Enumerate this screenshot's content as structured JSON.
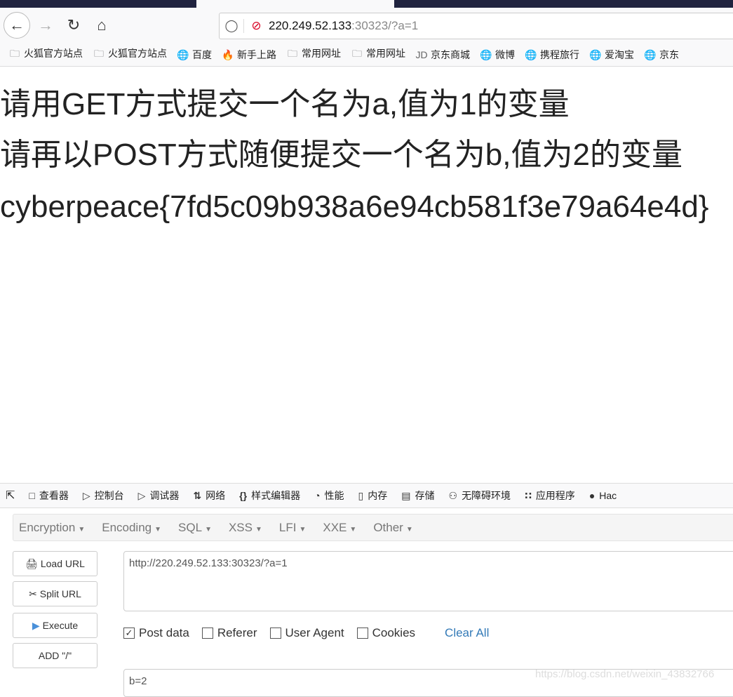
{
  "browser": {
    "url_host": "220.249.52.133",
    "url_rest": ":30323/?a=1",
    "bookmarks": [
      "火狐官方站点",
      "火狐官方站点",
      "百度",
      "新手上路",
      "常用网址",
      "常用网址",
      "京东商城",
      "微博",
      "携程旅行",
      "爱淘宝",
      "京东"
    ]
  },
  "page": {
    "lines": [
      "请用GET方式提交一个名为a,值为1的变量",
      "请再以POST方式随便提交一个名为b,值为2的变量",
      "cyberpeace{7fd5c09b938a6e94cb581f3e79a64e4d}"
    ]
  },
  "devtools": {
    "tabs": [
      "查看器",
      "控制台",
      "调试器",
      "网络",
      "样式编辑器",
      "性能",
      "内存",
      "存储",
      "无障碍环境",
      "应用程序",
      "Hac"
    ]
  },
  "hackbar": {
    "menus": [
      "Encryption",
      "Encoding",
      "SQL",
      "XSS",
      "LFI",
      "XXE",
      "Other"
    ],
    "buttons": {
      "load": "Load URL",
      "split": "Split URL",
      "execute": "Execute",
      "add": "ADD \"/\""
    },
    "url_value": "http://220.249.52.133:30323/?a=1",
    "options": [
      {
        "label": "Post data",
        "checked": true
      },
      {
        "label": "Referer",
        "checked": false
      },
      {
        "label": "User Agent",
        "checked": false
      },
      {
        "label": "Cookies",
        "checked": false
      }
    ],
    "clear_all": "Clear All",
    "post_value": "b=2"
  },
  "watermark": "https://blog.csdn.net/weixin_43832766"
}
